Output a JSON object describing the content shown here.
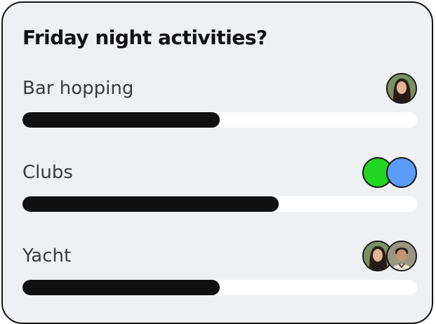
{
  "poll": {
    "title": "Friday night activities?",
    "options": [
      {
        "label": "Bar hopping",
        "fill_fraction": 0.5,
        "voters": [
          {
            "icon": "woman-photo-avatar",
            "color": "#6a5a4a"
          }
        ]
      },
      {
        "label": "Clubs",
        "fill_fraction": 0.65,
        "voters": [
          {
            "icon": "green-circle-avatar",
            "color": "#22d622"
          },
          {
            "icon": "blue-circle-avatar",
            "color": "#5b9cf8"
          }
        ]
      },
      {
        "label": "Yacht",
        "fill_fraction": 0.5,
        "voters": [
          {
            "icon": "woman-photo-avatar",
            "color": "#6a5a4a"
          },
          {
            "icon": "man-photo-avatar",
            "color": "#7f7a6a"
          }
        ]
      }
    ]
  },
  "colors": {
    "card_background": "#eff0f4",
    "bar_fill": "#101010",
    "bar_track": "#ffffff"
  }
}
